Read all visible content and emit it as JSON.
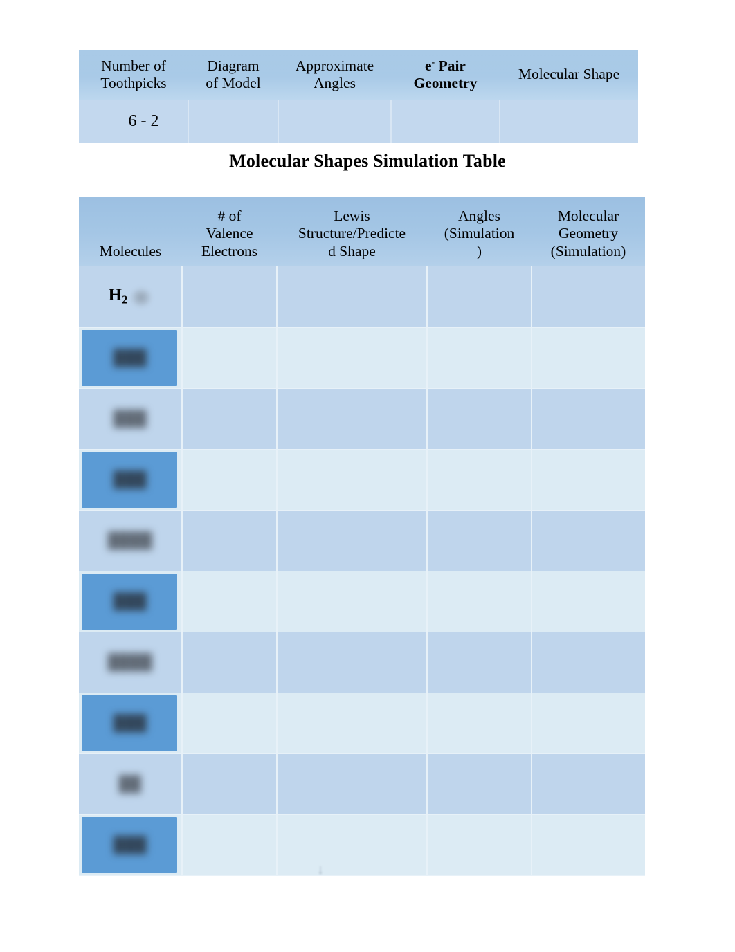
{
  "document": {
    "title": "Molecular Shapes Simulation Table"
  },
  "toothpick_table": {
    "headers": [
      "Number of Toothpicks",
      "Diagram of Model",
      "Approximate Angles",
      "e Pair Geometry",
      "Molecular Shape"
    ],
    "header_parts": {
      "col1_line1": "Number of",
      "col1_line2": "Toothpicks",
      "col2_line1": "Diagram",
      "col2_line2": "of Model",
      "col3_line1": "Approximate",
      "col3_line2": "Angles",
      "col4_line1_prefix": "e",
      "col4_line1_sup": "-",
      "col4_line1_suffix": " Pair",
      "col4_line2": "Geometry",
      "col5": "Molecular Shape"
    },
    "rows": [
      {
        "toothpicks": "6 - 2",
        "diagram": "",
        "angles": "",
        "e_pair_geometry": "",
        "molecular_shape": ""
      }
    ]
  },
  "simulation_table": {
    "headers": {
      "molecules": "Molecules",
      "valence": {
        "line1": "# of",
        "line2": "Valence",
        "line3": "Electrons"
      },
      "lewis": {
        "line1": "Lewis",
        "line2": "Structure/Predicte",
        "line3": "d Shape"
      },
      "angles": {
        "line1": "Angles",
        "line2": "(Simulation",
        "line3": ")"
      },
      "geometry": {
        "line1": "Molecular",
        "line2": "Geometry",
        "line3": "(Simulation)"
      }
    },
    "rows": [
      {
        "molecule": "H",
        "molecule_subscript": "2",
        "redacted": false,
        "highlighted": false,
        "valence": "",
        "lewis": "",
        "angles": "",
        "geometry": ""
      },
      {
        "molecule": "███",
        "redacted": true,
        "highlighted": true,
        "valence": "",
        "lewis": "",
        "angles": "",
        "geometry": ""
      },
      {
        "molecule": "███",
        "redacted": true,
        "highlighted": false,
        "valence": "",
        "lewis": "",
        "angles": "",
        "geometry": ""
      },
      {
        "molecule": "███",
        "redacted": true,
        "highlighted": true,
        "valence": "",
        "lewis": "",
        "angles": "",
        "geometry": ""
      },
      {
        "molecule": "████",
        "redacted": true,
        "highlighted": false,
        "valence": "",
        "lewis": "",
        "angles": "",
        "geometry": ""
      },
      {
        "molecule": "███",
        "redacted": true,
        "highlighted": true,
        "valence": "",
        "lewis": "",
        "angles": "",
        "geometry": ""
      },
      {
        "molecule": "████",
        "redacted": true,
        "highlighted": false,
        "valence": "",
        "lewis": "",
        "angles": "",
        "geometry": ""
      },
      {
        "molecule": "███",
        "redacted": true,
        "highlighted": true,
        "valence": "",
        "lewis": "",
        "angles": "",
        "geometry": ""
      },
      {
        "molecule": "██",
        "redacted": true,
        "highlighted": false,
        "valence": "",
        "lewis": "",
        "angles": "",
        "geometry": ""
      },
      {
        "molecule": "███",
        "redacted": true,
        "highlighted": true,
        "valence": "",
        "lewis": "",
        "angles": "",
        "geometry": ""
      }
    ]
  },
  "colors": {
    "header_blue": "#a4c6e5",
    "row_dark": "#bfd5ec",
    "row_light": "#dcebf4",
    "highlight_blue": "#5b9bd5",
    "grid_line": "#e7f1f8",
    "text": "#000000"
  },
  "artifact": {
    "glyph": "↓"
  }
}
